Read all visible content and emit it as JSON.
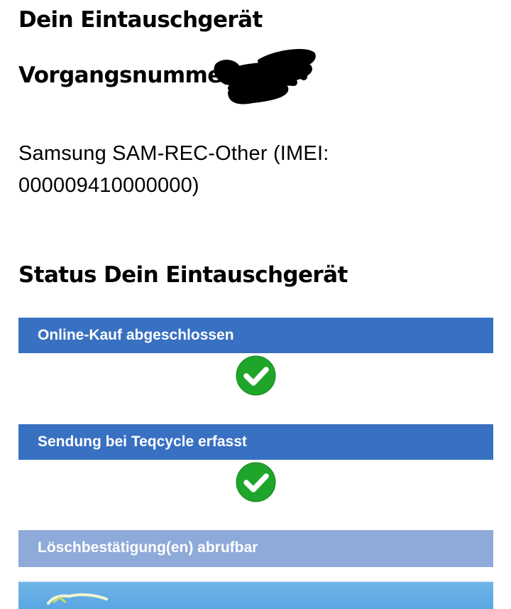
{
  "page": {
    "title": "Dein Eintauschgerät",
    "order_label": "Vorgangsnummer",
    "device_info": "Samsung SAM-REC-Other (IMEI: 000009410000000)",
    "status_heading": "Status Dein Eintauschgerät"
  },
  "status_steps": [
    {
      "label": "Online-Kauf abgeschlossen",
      "completed": true
    },
    {
      "label": "Sendung bei Teqcycle erfasst",
      "completed": true
    },
    {
      "label": "Löschbestätigung(en) abrufbar",
      "completed": false
    }
  ],
  "colors": {
    "step_done": "#3870c2",
    "step_pending": "#8daad8",
    "check_green": "#1ea52a"
  },
  "icons": {
    "redaction": "scribble-redaction",
    "step_done": "green-check-icon"
  }
}
